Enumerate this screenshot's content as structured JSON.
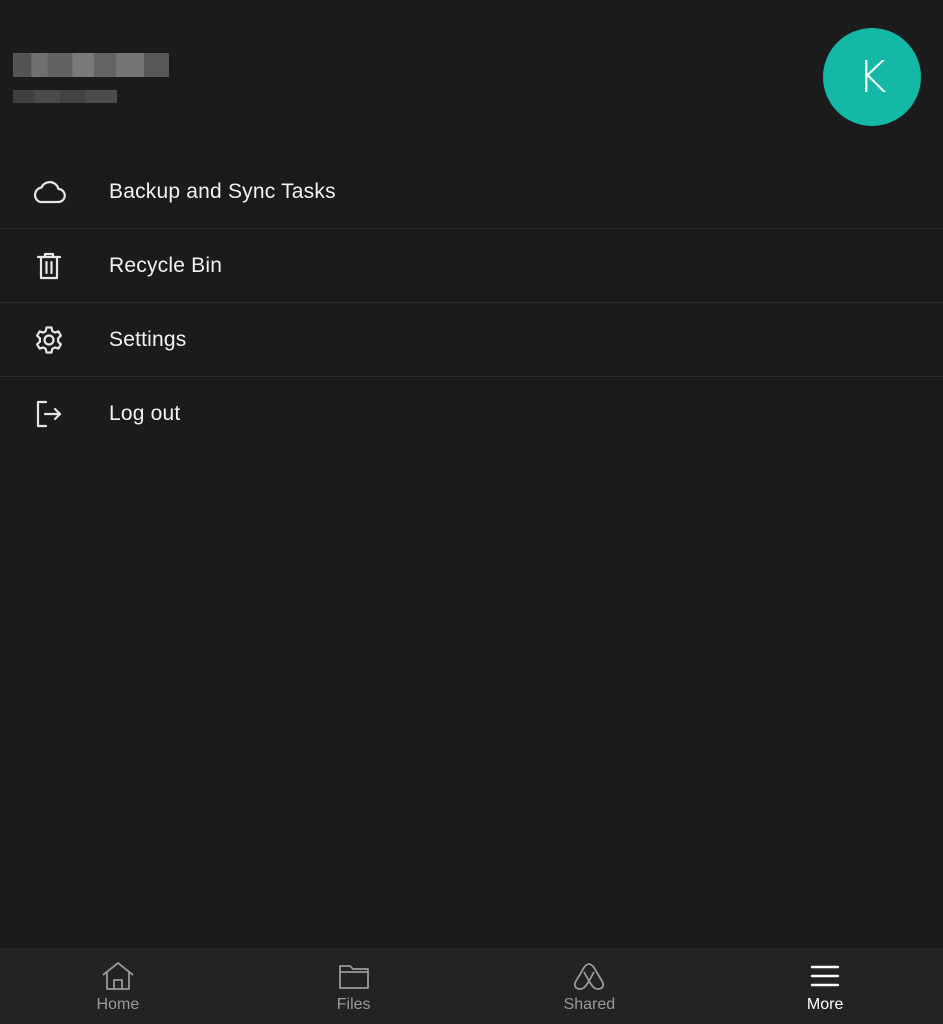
{
  "header": {
    "avatar_initial": "K",
    "avatar_color": "#13b9a6"
  },
  "menu": {
    "items": [
      {
        "label": "Backup and Sync Tasks",
        "icon": "cloud-icon"
      },
      {
        "label": "Recycle Bin",
        "icon": "trash-icon"
      },
      {
        "label": "Settings",
        "icon": "gear-icon"
      },
      {
        "label": "Log out",
        "icon": "logout-icon"
      }
    ]
  },
  "bottom_nav": {
    "active": "More",
    "items": [
      {
        "label": "Home",
        "icon": "home-icon"
      },
      {
        "label": "Files",
        "icon": "folder-icon"
      },
      {
        "label": "Shared",
        "icon": "shared-icon"
      },
      {
        "label": "More",
        "icon": "menu-icon"
      }
    ]
  }
}
